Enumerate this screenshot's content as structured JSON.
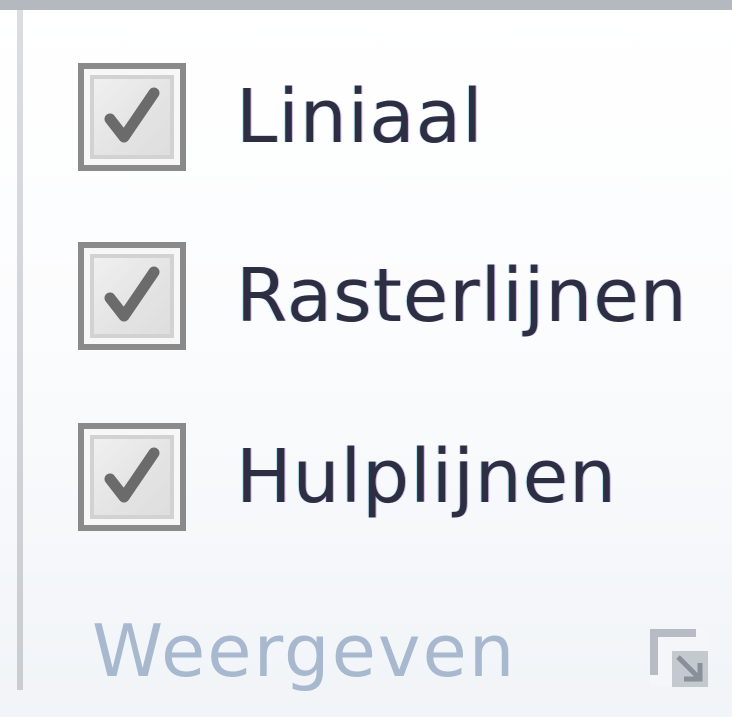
{
  "group": {
    "title": "Weergeven",
    "items": [
      {
        "label": "Liniaal",
        "checked": true
      },
      {
        "label": "Rasterlijnen",
        "checked": true
      },
      {
        "label": "Hulplijnen",
        "checked": true
      }
    ],
    "launcher_icon": "dialog-launcher-icon"
  },
  "colors": {
    "label_text": "#2e2e42",
    "title_text": "#a8b8cf",
    "checkbox_border": "#8a8a8a",
    "checkmark": "#6b6b6b"
  }
}
